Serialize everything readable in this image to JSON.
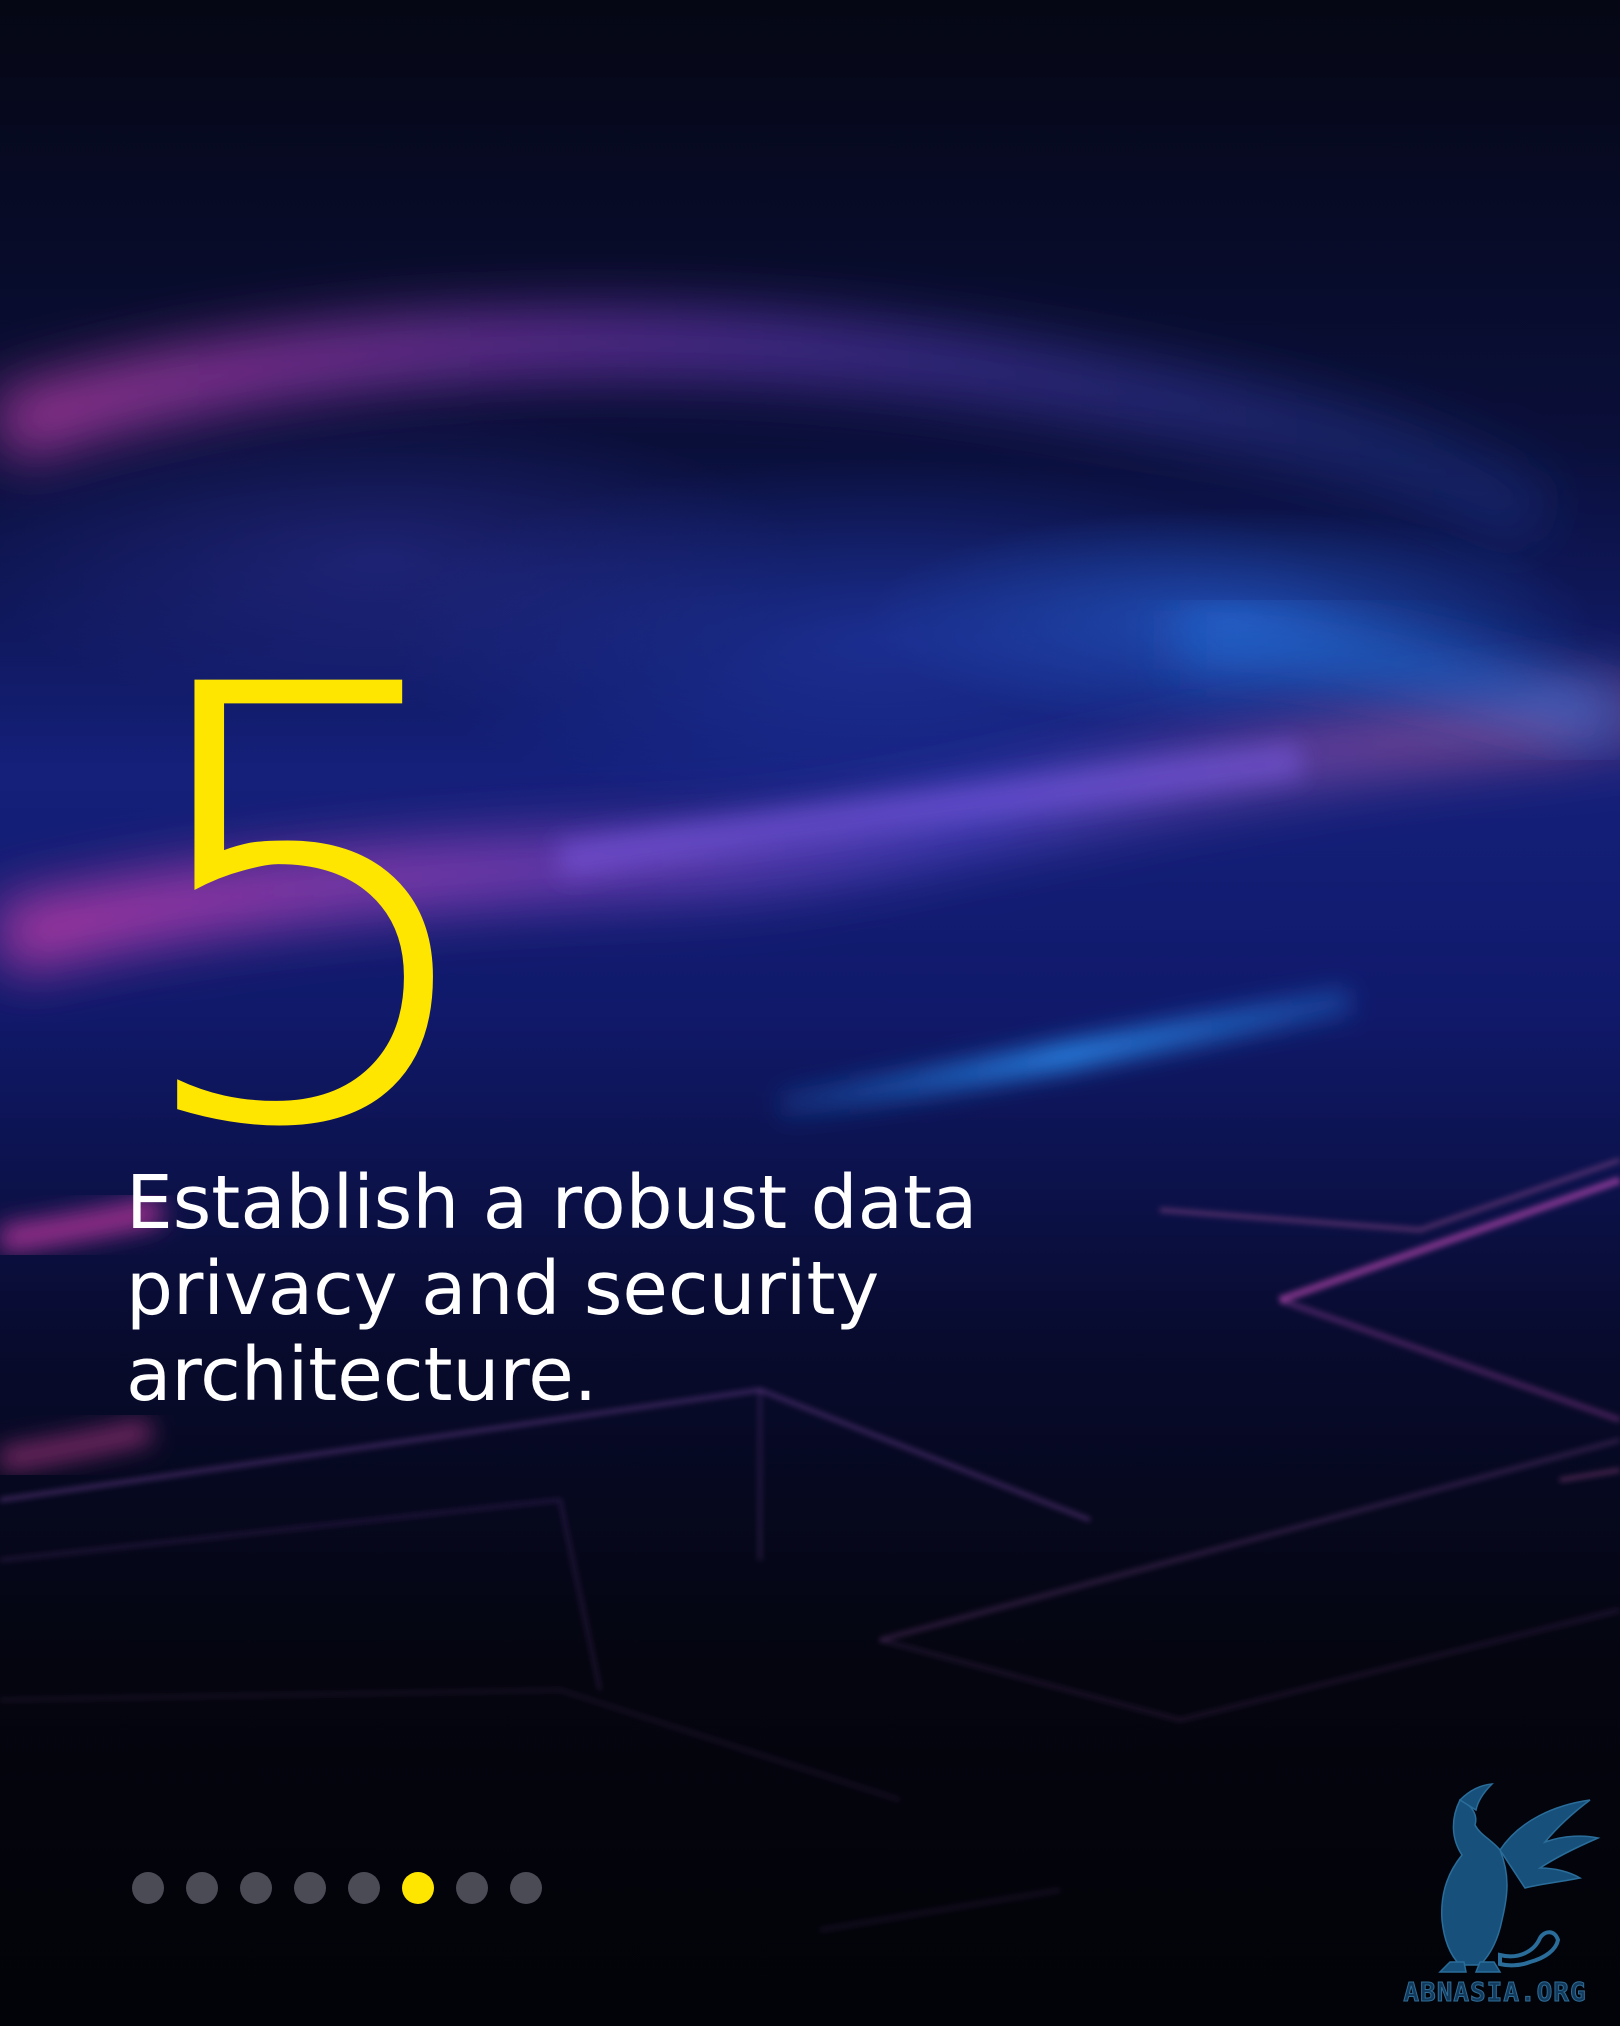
{
  "slide": {
    "number": "5",
    "statement_line1": "Establish a robust data",
    "statement_line2": "privacy and security",
    "statement_line3": "architecture."
  },
  "pager": {
    "total": 8,
    "active_index": 5
  },
  "watermark": {
    "text": "ABNASIA.ORG",
    "icon": "griffin-icon"
  },
  "colors": {
    "accent": "#ffe600",
    "text": "#ffffff",
    "dot_inactive": "#4a4b55",
    "watermark": "#123a5c"
  }
}
